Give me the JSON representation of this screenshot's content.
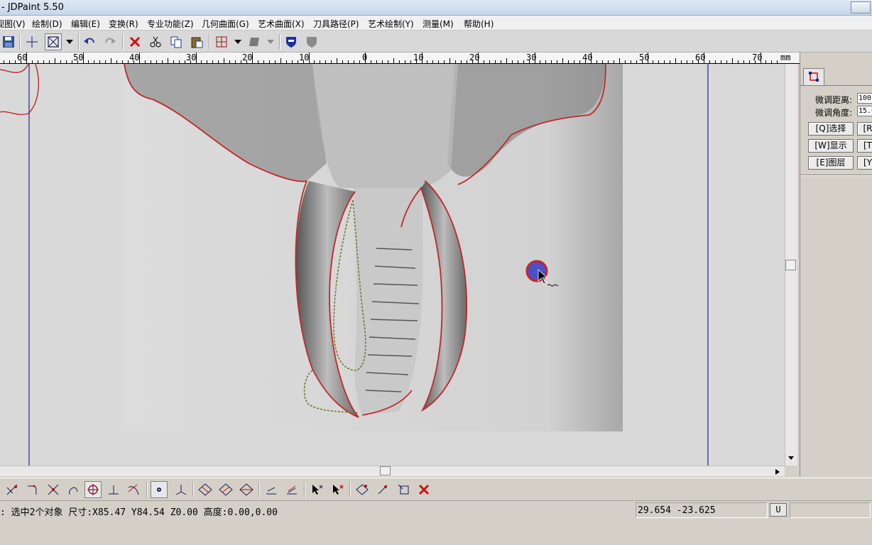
{
  "window": {
    "title": "- JDPaint 5.50"
  },
  "menu": [
    "视图(V)",
    "绘制(D)",
    "编辑(E)",
    "变换(R)",
    "专业功能(Z)",
    "几何曲面(G)",
    "艺术曲面(X)",
    "刀具路径(P)",
    "艺术绘制(Y)",
    "测量(M)",
    "帮助(H)"
  ],
  "toolbar": {
    "icons": [
      "save-icon",
      "snap-cross-icon",
      "select-window-icon",
      "dropdown-icon",
      "undo-icon",
      "redo-icon",
      "delete-icon",
      "cut-icon",
      "copy-icon",
      "paste-icon",
      "node-edit-icon",
      "shape-icon",
      "shield-blue-icon",
      "shield-gray-icon"
    ]
  },
  "ruler": {
    "labels": [
      "60",
      "50",
      "40",
      "30",
      "20",
      "10",
      "0",
      "10",
      "20",
      "30",
      "40",
      "50",
      "60",
      "70"
    ],
    "unit": "mm"
  },
  "right_panel": {
    "fine_distance_label": "微调距离:",
    "fine_distance_value": "100",
    "fine_angle_label": "微调角度:",
    "fine_angle_value": "15.0",
    "buttons": [
      "[Q]选择",
      "[W]显示",
      "[E]图层"
    ],
    "buttons_right": [
      "[R",
      "[T",
      "[Y"
    ]
  },
  "bottom_toolbar": {
    "icons": [
      "trim-icon",
      "corner-icon",
      "intersect-icon",
      "arc-icon",
      "circle-node-icon",
      "perpendicular-icon",
      "tangent-icon",
      "point-icon",
      "axis-icon",
      "diamond-icon-1",
      "diamond-icon-2",
      "diamond-icon-3",
      "align-icon-1",
      "align-icon-2",
      "pick-add-icon",
      "pick-remove-icon",
      "transform-icon-1",
      "transform-icon-2",
      "transform-icon-3",
      "clear-icon"
    ]
  },
  "status": {
    "message": ": 选中2个对象 尺寸:X85.47 Y84.54 Z0.00 高度:0.00,0.00",
    "coordinates": "29.654 -23.625",
    "unit_button": "U"
  },
  "colors": {
    "outline_red": "#c0282a",
    "outline_dashed": "#5a6a2a",
    "guide_line": "#1a2a8a",
    "cursor_fill": "#4b4fc8"
  }
}
